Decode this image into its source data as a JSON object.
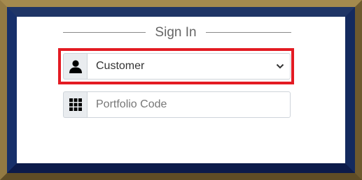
{
  "form": {
    "title": "Sign In",
    "role_select": {
      "icon": "user-icon",
      "selected": "Customer"
    },
    "portfolio_code": {
      "icon": "grid-icon",
      "placeholder": "Portfolio Code",
      "value": ""
    }
  },
  "colors": {
    "frame_gold": "#8a7440",
    "frame_navy": "#142a5e",
    "highlight": "#e31b23",
    "addon_bg": "#e9ecef"
  }
}
